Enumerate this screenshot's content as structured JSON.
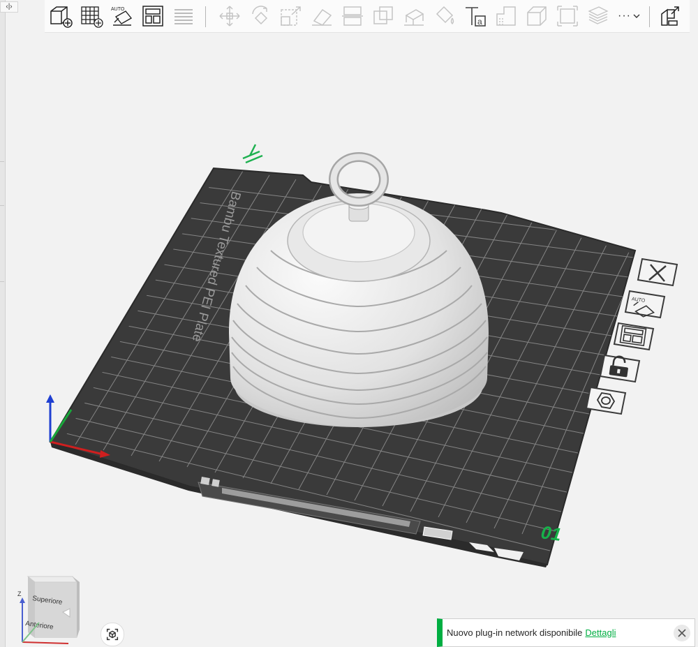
{
  "toolbar": {
    "buttons": [
      {
        "name": "add-object-button",
        "icon": "cube-plus-icon"
      },
      {
        "name": "add-plate-button",
        "icon": "grid-plus-icon"
      },
      {
        "name": "auto-orient-button",
        "icon": "auto-orient-icon",
        "text": "AUTO"
      },
      {
        "name": "arrange-button",
        "icon": "arrange-icon"
      },
      {
        "name": "split-layers-button",
        "icon": "layers-icon"
      },
      {
        "name": "move-button",
        "icon": "move-icon"
      },
      {
        "name": "rotate-button",
        "icon": "rotate-icon"
      },
      {
        "name": "scale-button",
        "icon": "scale-icon"
      },
      {
        "name": "lay-on-face-button",
        "icon": "lay-on-face-icon"
      },
      {
        "name": "cut-button",
        "icon": "cut-icon"
      },
      {
        "name": "boolean-button",
        "icon": "boolean-icon"
      },
      {
        "name": "support-paint-button",
        "icon": "support-paint-icon"
      },
      {
        "name": "color-paint-button",
        "icon": "paint-bucket-icon"
      },
      {
        "name": "text-button",
        "icon": "text-icon"
      },
      {
        "name": "seam-button",
        "icon": "seam-icon"
      },
      {
        "name": "measure-button",
        "icon": "measure-icon"
      },
      {
        "name": "assembly-button",
        "icon": "assembly-icon"
      },
      {
        "name": "variable-layer-button",
        "icon": "variable-layer-icon"
      },
      {
        "name": "more-tools-button",
        "icon": "more-icon",
        "text": "···"
      },
      {
        "name": "split-to-parts-button",
        "icon": "split-parts-icon"
      }
    ]
  },
  "plate": {
    "label": "Bambu Textured PEI Plate",
    "number": "01"
  },
  "side_toolbar": [
    {
      "name": "delete-plate-button",
      "icon": "close-icon"
    },
    {
      "name": "auto-orient-plate-button",
      "icon": "auto-orient-icon",
      "text": "AUTO"
    },
    {
      "name": "arrange-plate-button",
      "icon": "arrange-icon"
    },
    {
      "name": "lock-plate-button",
      "icon": "unlock-icon"
    },
    {
      "name": "plate-settings-button",
      "icon": "hexagon-nut-icon"
    }
  ],
  "view_cube": {
    "top": "Superiore",
    "front": "Anteriore",
    "axis_z": "Z"
  },
  "notification": {
    "message": "Nuovo plug-in network disponibile",
    "link": "Dettagli"
  },
  "colors": {
    "accent": "#00ae42",
    "plate": "#3b3b3b",
    "grid": "#8a8a8a",
    "model": "#dcdcdc"
  }
}
